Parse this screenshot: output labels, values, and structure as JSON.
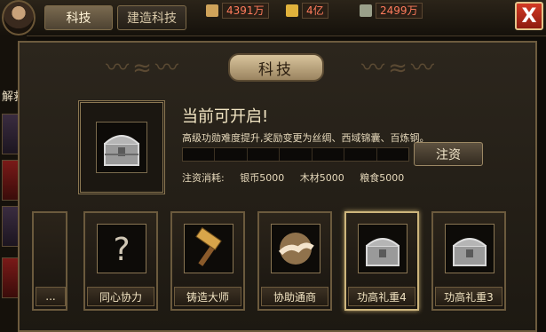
{
  "top_bar": {
    "tabs": [
      {
        "label": "科技",
        "active": true
      },
      {
        "label": "建造科技",
        "active": false
      }
    ],
    "resources": [
      {
        "icon": "silver-bar-icon",
        "value": "4391万"
      },
      {
        "icon": "gold-icon",
        "value": "4亿"
      },
      {
        "icon": "food-icon",
        "value": "2499万"
      }
    ],
    "close_label": "X"
  },
  "left_strip": {
    "fragment_text": "解救"
  },
  "panel": {
    "title": "科技",
    "current_item": {
      "heading": "当前可开启!",
      "description": "高级功勋难度提升,奖励变更为丝绸、西域锦囊、百炼钢。",
      "progress": 0,
      "progress_segments": 7,
      "invest_label": "注资",
      "cost_label": "注资消耗:",
      "costs": [
        {
          "name": "银币",
          "amount": "5000"
        },
        {
          "name": "木材",
          "amount": "5000"
        },
        {
          "name": "粮食",
          "amount": "5000"
        }
      ]
    },
    "skills": [
      {
        "label": "...",
        "icon": "partial-icon",
        "selected": false
      },
      {
        "label": "同心协力",
        "icon": "question-mark-icon",
        "selected": false
      },
      {
        "label": "铸造大师",
        "icon": "hammer-icon",
        "selected": false
      },
      {
        "label": "协助通商",
        "icon": "handshake-icon",
        "selected": false
      },
      {
        "label": "功高礼重4",
        "icon": "treasure-chest-icon",
        "selected": true
      },
      {
        "label": "功高礼重3",
        "icon": "treasure-chest-icon",
        "selected": false
      }
    ]
  },
  "colors": {
    "accent": "#b9a067",
    "close": "#d33a24",
    "resource_value": "#ff7b5c"
  }
}
